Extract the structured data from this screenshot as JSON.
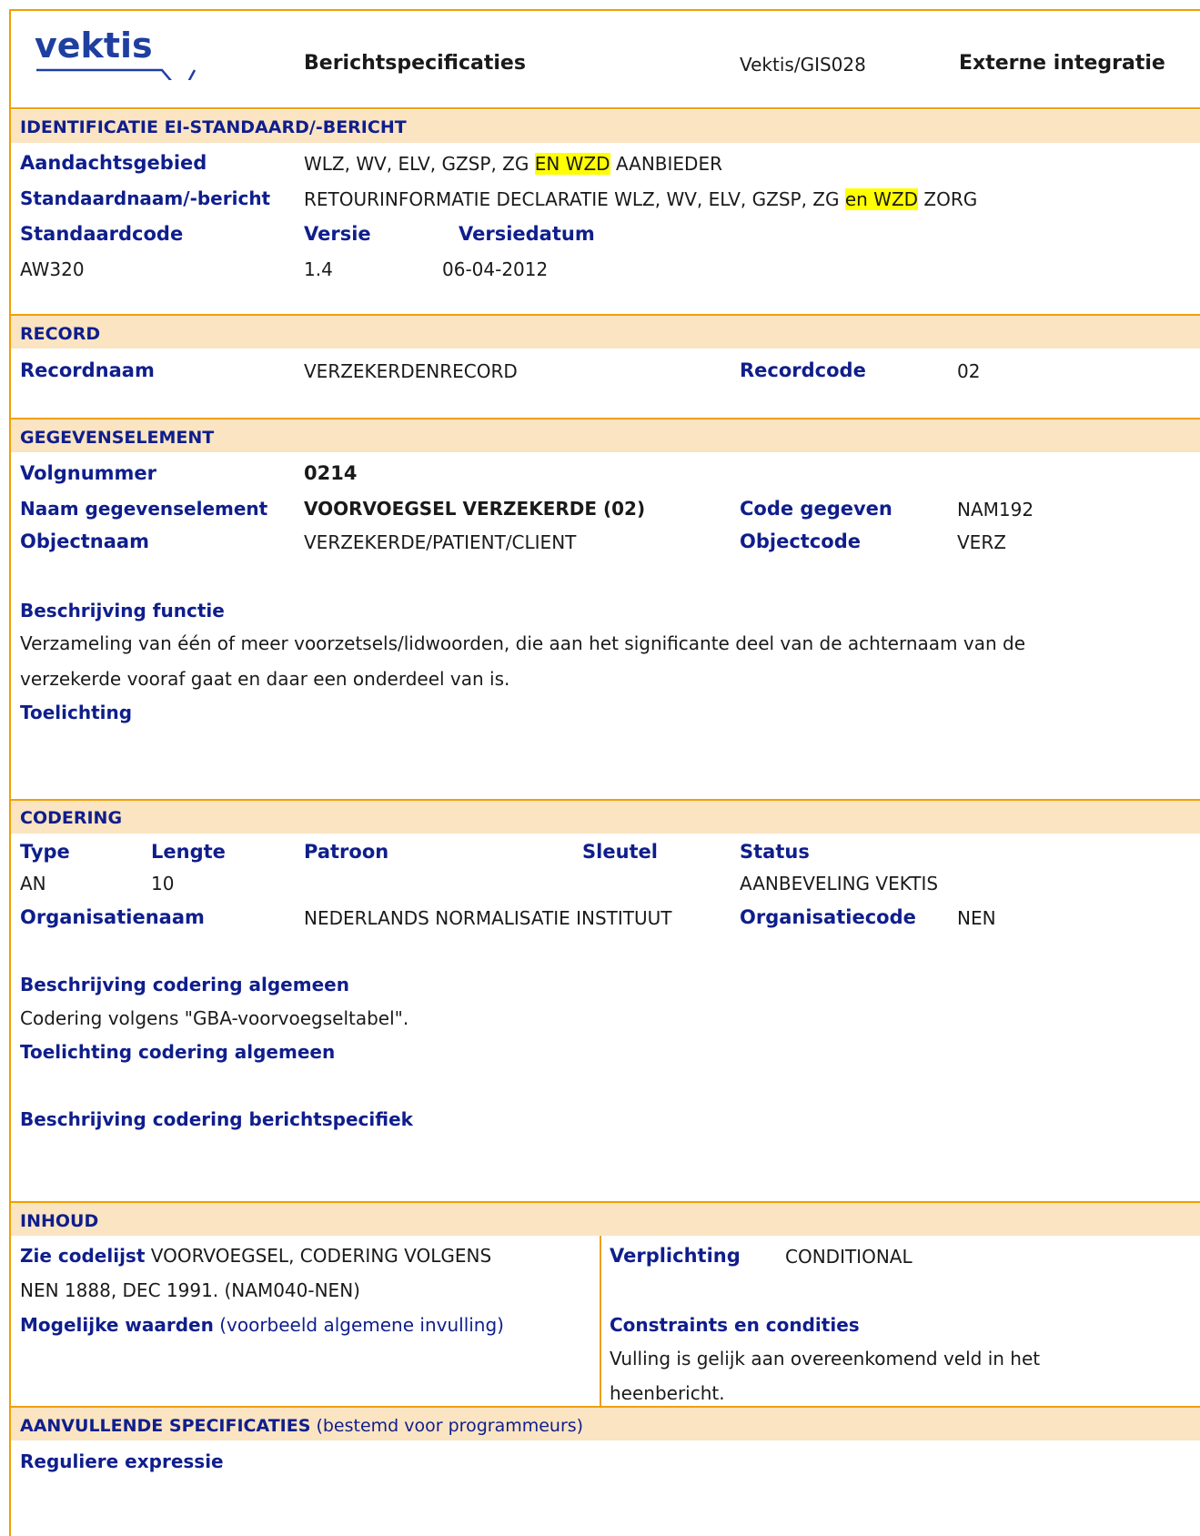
{
  "header": {
    "logo_text": "vektis",
    "doc_type": "Berichtspecificaties",
    "doc_code": "Vektis/GIS028",
    "doc_scope": "Externe integratie"
  },
  "identificatie": {
    "section_title": "IDENTIFICATIE EI-STANDAARD/-BERICHT",
    "aandachtsgebied_label": "Aandachtsgebied",
    "aandachtsgebied_pre": "WLZ, WV, ELV, GZSP, ZG ",
    "aandachtsgebied_hl": "EN WZD",
    "aandachtsgebied_post": " AANBIEDER",
    "standaardnaam_label": "Standaardnaam/-bericht",
    "standaardnaam_pre": "RETOURINFORMATIE DECLARATIE WLZ, WV, ELV, GZSP, ZG ",
    "standaardnaam_hl": "en WZD",
    "standaardnaam_post": " ZORG",
    "standaardcode_label": "Standaardcode",
    "versie_label": "Versie",
    "versiedatum_label": "Versiedatum",
    "standaardcode": "AW320",
    "versie": "1.4",
    "versiedatum": "06-04-2012"
  },
  "record": {
    "section_title": "RECORD",
    "recordnaam_label": "Recordnaam",
    "recordnaam": "VERZEKERDENRECORD",
    "recordcode_label": "Recordcode",
    "recordcode": "02"
  },
  "gegevenselement": {
    "section_title": "GEGEVENSELEMENT",
    "volgnummer_label": "Volgnummer",
    "volgnummer": "0214",
    "naam_label": "Naam gegevenselement",
    "naam": "VOORVOEGSEL VERZEKERDE (02)",
    "code_gegeven_label": "Code gegeven",
    "code_gegeven": "NAM192",
    "objectnaam_label": "Objectnaam",
    "objectnaam": "VERZEKERDE/PATIENT/CLIENT",
    "objectcode_label": "Objectcode",
    "objectcode": "VERZ",
    "beschrijving_label": "Beschrijving functie",
    "beschrijving_line1": "Verzameling van één of meer voorzetsels/lidwoorden, die aan het significante deel van de achternaam van de",
    "beschrijving_line2": "verzekerde vooraf gaat en daar een onderdeel van is.",
    "toelichting_label": "Toelichting"
  },
  "codering": {
    "section_title": "CODERING",
    "type_label": "Type",
    "lengte_label": "Lengte",
    "patroon_label": "Patroon",
    "sleutel_label": "Sleutel",
    "status_label": "Status",
    "type": "AN",
    "lengte": "10",
    "status": "AANBEVELING VEKTIS",
    "organisatienaam_label": "Organisatienaam",
    "organisatienaam": "NEDERLANDS NORMALISATIE INSTITUUT",
    "organisatiecode_label": "Organisatiecode",
    "organisatiecode": "NEN",
    "beschrijving_algemeen_label": "Beschrijving codering algemeen",
    "beschrijving_algemeen": "Codering volgens \"GBA-voorvoegseltabel\".",
    "toelichting_algemeen_label": "Toelichting codering algemeen",
    "beschrijving_berichtspecifiek_label": "Beschrijving codering berichtspecifiek"
  },
  "inhoud": {
    "section_title": "INHOUD",
    "codelijst_label": "Zie codelijst",
    "codelijst_line1": " VOORVOEGSEL, CODERING VOLGENS",
    "codelijst_line2": "NEN 1888, DEC 1991. (NAM040-NEN)",
    "mogelijke_label": "Mogelijke waarden",
    "mogelijke_note": " (voorbeeld algemene invulling)",
    "verplichting_label": "Verplichting",
    "verplichting": "CONDITIONAL",
    "constraints_label": "Constraints en condities",
    "constraints_line1": "Vulling is gelijk aan overeenkomend veld in het",
    "constraints_line2": "heenbericht."
  },
  "aanvullend": {
    "section_title": "AANVULLENDE SPECIFICATIES",
    "section_note": " (bestemd voor programmeurs)",
    "regex_label": "Reguliere expressie"
  },
  "colors": {
    "border": "#f0a000",
    "band": "#fbe4c2",
    "label_blue": "#0f1e8c",
    "highlight": "#ffff00"
  }
}
